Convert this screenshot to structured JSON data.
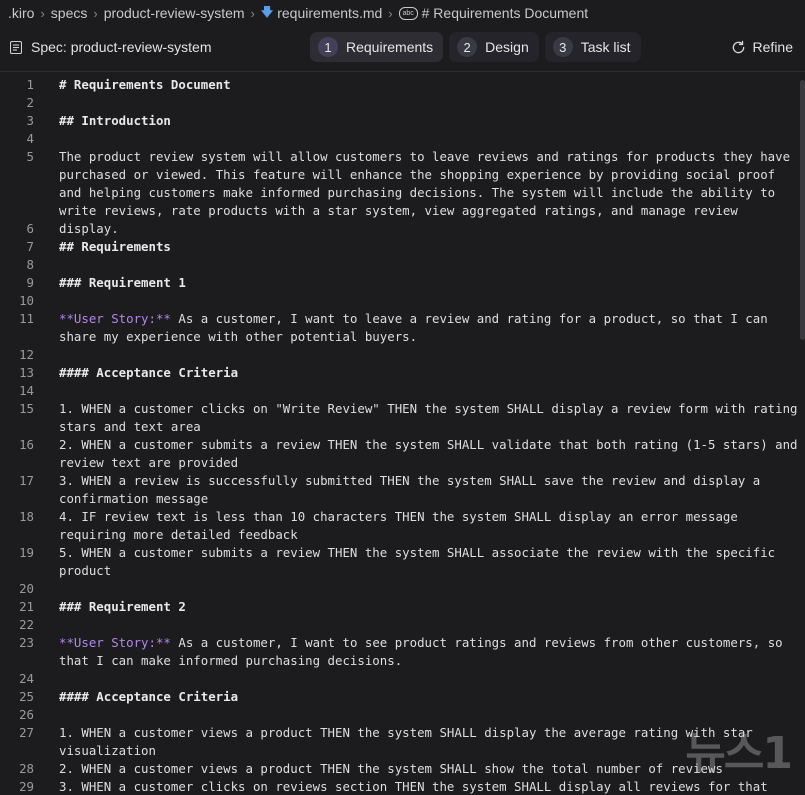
{
  "breadcrumb": {
    "items": [
      ".kiro",
      "specs",
      "product-review-system",
      "requirements.md",
      "# Requirements Document"
    ]
  },
  "header": {
    "spec_title": "Spec: product-review-system",
    "tabs": [
      {
        "num": "1",
        "label": "Requirements",
        "active": true
      },
      {
        "num": "2",
        "label": "Design",
        "active": false
      },
      {
        "num": "3",
        "label": "Task list",
        "active": false
      }
    ],
    "refine_label": "Refine"
  },
  "editor": {
    "lines": [
      {
        "n": "1",
        "text": "# Requirements Document",
        "style": "h"
      },
      {
        "n": "2",
        "text": "",
        "style": ""
      },
      {
        "n": "3",
        "text": "## Introduction",
        "style": "h"
      },
      {
        "n": "4",
        "text": "",
        "style": ""
      },
      {
        "n": "5",
        "text": "The product review system will allow customers to leave reviews and ratings for products they have purchased or viewed. This feature will enhance the shopping experience by providing social proof and helping customers make informed purchasing decisions. The system will include the ability to write reviews, rate products with a star system, view aggregated ratings, and manage review display.",
        "style": ""
      },
      {
        "n": "6",
        "text": "",
        "style": ""
      },
      {
        "n": "7",
        "text": "## Requirements",
        "style": "h"
      },
      {
        "n": "8",
        "text": "",
        "style": ""
      },
      {
        "n": "9",
        "text": "### Requirement 1",
        "style": "h"
      },
      {
        "n": "10",
        "text": "",
        "style": ""
      },
      {
        "n": "11",
        "story": "**User Story:**",
        "text": " As a customer, I want to leave a review and rating for a product, so that I can share my experience with other potential buyers.",
        "style": "story"
      },
      {
        "n": "12",
        "text": "",
        "style": ""
      },
      {
        "n": "13",
        "text": "#### Acceptance Criteria",
        "style": "h"
      },
      {
        "n": "14",
        "text": "",
        "style": ""
      },
      {
        "n": "15",
        "text": "1. WHEN a customer clicks on \"Write Review\" THEN the system SHALL display a review form with rating stars and text area",
        "style": ""
      },
      {
        "n": "16",
        "text": "2. WHEN a customer submits a review THEN the system SHALL validate that both rating (1-5 stars) and review text are provided",
        "style": ""
      },
      {
        "n": "17",
        "text": "3. WHEN a review is successfully submitted THEN the system SHALL save the review and display a confirmation message",
        "style": ""
      },
      {
        "n": "18",
        "text": "4. IF review text is less than 10 characters THEN the system SHALL display an error message requiring more detailed feedback",
        "style": ""
      },
      {
        "n": "19",
        "text": "5. WHEN a customer submits a review THEN the system SHALL associate the review with the specific product",
        "style": ""
      },
      {
        "n": "20",
        "text": "",
        "style": ""
      },
      {
        "n": "21",
        "text": "### Requirement 2",
        "style": "h"
      },
      {
        "n": "22",
        "text": "",
        "style": ""
      },
      {
        "n": "23",
        "story": "**User Story:**",
        "text": " As a customer, I want to see product ratings and reviews from other customers, so that I can make informed purchasing decisions.",
        "style": "story"
      },
      {
        "n": "24",
        "text": "",
        "style": ""
      },
      {
        "n": "25",
        "text": "#### Acceptance Criteria",
        "style": "h"
      },
      {
        "n": "26",
        "text": "",
        "style": ""
      },
      {
        "n": "27",
        "text": "1. WHEN a customer views a product THEN the system SHALL display the average rating with star visualization",
        "style": ""
      },
      {
        "n": "28",
        "text": "2. WHEN a customer views a product THEN the system SHALL show the total number of reviews",
        "style": ""
      },
      {
        "n": "29",
        "text": "3. WHEN a customer clicks on reviews section THEN the system SHALL display all reviews for that",
        "style": ""
      }
    ]
  },
  "watermark": "뉴스1"
}
